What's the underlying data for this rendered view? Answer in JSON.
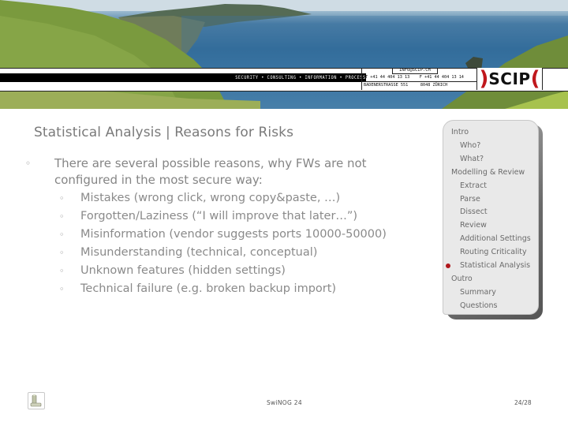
{
  "header": {
    "tagline": "SECURITY • CONSULTING • INFORMATION • PROCESS",
    "email": "INFO@SCIP.CH",
    "phone": "T +41 44 404 13 13",
    "fax": "F +41 44 404 13 14",
    "street": "BADENERSTRASSE 551",
    "city": "8048 ZÜRICH",
    "logo": {
      "left_paren": ")",
      "text": "SCIP",
      "right_paren": "(",
      "accent_color": "#c0171c"
    }
  },
  "slide": {
    "title": "Statistical Analysis | Reasons for Risks",
    "main_bullet": {
      "marker": "◦",
      "text": "There are several possible reasons, why FWs are not configured in the most secure way:"
    },
    "sub_bullets": [
      {
        "marker": "◦",
        "text": "Mistakes (wrong click, wrong copy&paste, …)"
      },
      {
        "marker": "◦",
        "text": "Forgotten/Laziness (“I will improve that later…”)"
      },
      {
        "marker": "◦",
        "text": "Misinformation (vendor suggests ports 10000-50000)"
      },
      {
        "marker": "◦",
        "text": "Misunderstanding (technical, conceptual)"
      },
      {
        "marker": "◦",
        "text": "Unknown features (hidden settings)"
      },
      {
        "marker": "◦",
        "text": "Technical failure (e.g. broken backup import)"
      }
    ]
  },
  "navigation": {
    "items": [
      {
        "label": "Intro",
        "level": 0,
        "active": false
      },
      {
        "label": "Who?",
        "level": 1,
        "active": false
      },
      {
        "label": "What?",
        "level": 1,
        "active": false
      },
      {
        "label": "Modelling & Review",
        "level": 0,
        "active": false
      },
      {
        "label": "Extract",
        "level": 1,
        "active": false
      },
      {
        "label": "Parse",
        "level": 1,
        "active": false
      },
      {
        "label": "Dissect",
        "level": 1,
        "active": false
      },
      {
        "label": "Review",
        "level": 1,
        "active": false
      },
      {
        "label": "Additional Settings",
        "level": 1,
        "active": false
      },
      {
        "label": "Routing Criticality",
        "level": 1,
        "active": false
      },
      {
        "label": "Statistical Analysis",
        "level": 1,
        "active": true
      },
      {
        "label": "Outro",
        "level": 0,
        "active": false
      },
      {
        "label": "Summary",
        "level": 1,
        "active": false
      },
      {
        "label": "Questions",
        "level": 1,
        "active": false
      }
    ],
    "active_marker_color": "#b0171c"
  },
  "footer": {
    "icon": "document-stack-icon",
    "event": "SwiNOG 24",
    "page": "24/28"
  }
}
